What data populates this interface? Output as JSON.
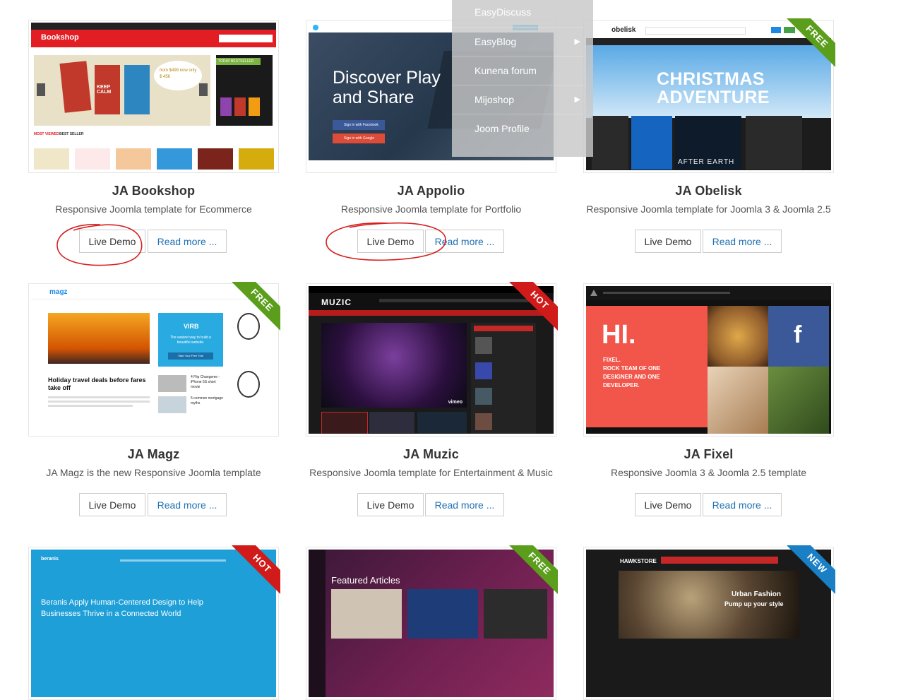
{
  "templates": [
    {
      "title": "JA Bookshop",
      "desc": "Responsive Joomla template for Ecommerce",
      "live": "Live Demo",
      "more": "Read more ...",
      "ribbon": ""
    },
    {
      "title": "JA Appolio",
      "desc": "Responsive Joomla template for Portfolio",
      "live": "Live Demo",
      "more": "Read more ...",
      "ribbon": ""
    },
    {
      "title": "JA Obelisk",
      "desc": "Responsive Joomla template for Joomla 3 & Joomla 2.5",
      "live": "Live Demo",
      "more": "Read more ...",
      "ribbon": "FREE"
    },
    {
      "title": "JA Magz",
      "desc": "JA Magz is the new Responsive Joomla template",
      "live": "Live Demo",
      "more": "Read more ...",
      "ribbon": "FREE"
    },
    {
      "title": "JA Muzic",
      "desc": "Responsive Joomla template for Entertainment & Music",
      "live": "Live Demo",
      "more": "Read more ...",
      "ribbon": "HOT"
    },
    {
      "title": "JA Fixel",
      "desc": "Responsive Joomla 3 & Joomla 2.5 template",
      "live": "Live Demo",
      "more": "Read more ...",
      "ribbon": ""
    },
    {
      "title": "",
      "desc": "",
      "live": "",
      "more": "",
      "ribbon": "HOT"
    },
    {
      "title": "",
      "desc": "",
      "live": "",
      "more": "",
      "ribbon": "FREE"
    },
    {
      "title": "",
      "desc": "",
      "live": "",
      "more": "",
      "ribbon": "NEW"
    }
  ],
  "dropdown": {
    "header": "EasyDiscuss",
    "items": [
      "EasyBlog",
      "Kunena forum",
      "Mijoshop",
      "Joom Profile"
    ]
  },
  "previews": {
    "bookshop": {
      "logo": "Bookshop",
      "promo": "from $499 now only $ 456",
      "keep_calm": "KEEP CALM",
      "tab1": "MOST VIEWED",
      "tab2": "BEST SELLER",
      "badge": "TODAY BESTSELLER"
    },
    "appolio": {
      "headline1": "Discover Play",
      "headline2": "and Share",
      "fb": "Sign in with Facebook",
      "google": "Sign in with Google",
      "cta": "Try Discover Free"
    },
    "obelisk": {
      "logo": "obelisk",
      "hero1": "CHRISTMAS",
      "hero2": "ADVENTURE",
      "movie": "AFTER EARTH"
    },
    "magz": {
      "logo": "magz",
      "headline": "Holiday travel deals before fares take off",
      "ad_brand": "VIRB",
      "ad_text": "The easiest way to build a beautiful website.",
      "ad_btn": "Start Your Free Trial",
      "side1": "4 Flip Changeme - iPhone 5S short movie",
      "side2": "5 common mortgage myths"
    },
    "muzic": {
      "logo": "MUZIC",
      "tag": "vimeo"
    },
    "fixel": {
      "hi": "HI.",
      "line1": "FIXEL.",
      "line2": "ROCK TEAM OF ONE",
      "line3": "DESIGNER AND ONE",
      "line4": "DEVELOPER.",
      "fb": "f"
    },
    "beranis": {
      "logo": "beranis",
      "text1": "Beranis Apply Human-Centered Design to Help",
      "text2": "Businesses Thrive in a Connected World"
    },
    "featured": {
      "heading": "Featured Articles"
    },
    "hawk": {
      "logo": "HAWKSTORE",
      "line1": "Urban Fashion",
      "line2": "Pump up your style"
    }
  },
  "colors": {
    "ribbon_free": "#5a9e1c",
    "ribbon_hot": "#d11a1a",
    "ribbon_new": "#1a7fc4",
    "link": "#1f6fb2",
    "annotation": "#d62020"
  }
}
